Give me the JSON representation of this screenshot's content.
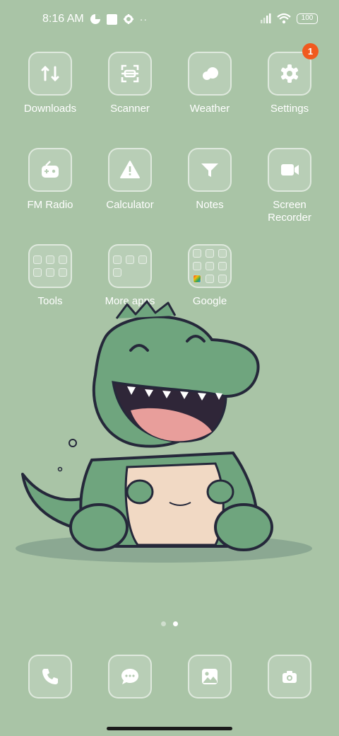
{
  "status_bar": {
    "time": "8:16 AM",
    "battery": "100",
    "icons": [
      "data-saver-icon",
      "square-notification-icon",
      "gear-icon",
      "more-dots-icon",
      "signal-icon",
      "wifi-icon",
      "battery-icon"
    ]
  },
  "apps": [
    {
      "label": "Downloads",
      "icon": "downloads-icon"
    },
    {
      "label": "Scanner",
      "icon": "scanner-icon"
    },
    {
      "label": "Weather",
      "icon": "weather-icon"
    },
    {
      "label": "Settings",
      "icon": "settings-gear-icon",
      "badge": "1"
    },
    {
      "label": "FM Radio",
      "icon": "radio-icon"
    },
    {
      "label": "Calculator",
      "icon": "calculator-icon"
    },
    {
      "label": "Notes",
      "icon": "notes-icon"
    },
    {
      "label": "Screen\nRecorder",
      "icon": "screen-recorder-icon"
    }
  ],
  "folders": [
    {
      "label": "Tools"
    },
    {
      "label": "More apps"
    },
    {
      "label": "Google"
    }
  ],
  "dock": [
    {
      "icon": "phone-icon"
    },
    {
      "icon": "messages-icon"
    },
    {
      "icon": "gallery-icon"
    },
    {
      "icon": "camera-icon"
    }
  ],
  "page_indicator": {
    "pages": 2,
    "active": 2
  },
  "colors": {
    "background": "#a9c4a6",
    "badge": "#f15a1f"
  }
}
